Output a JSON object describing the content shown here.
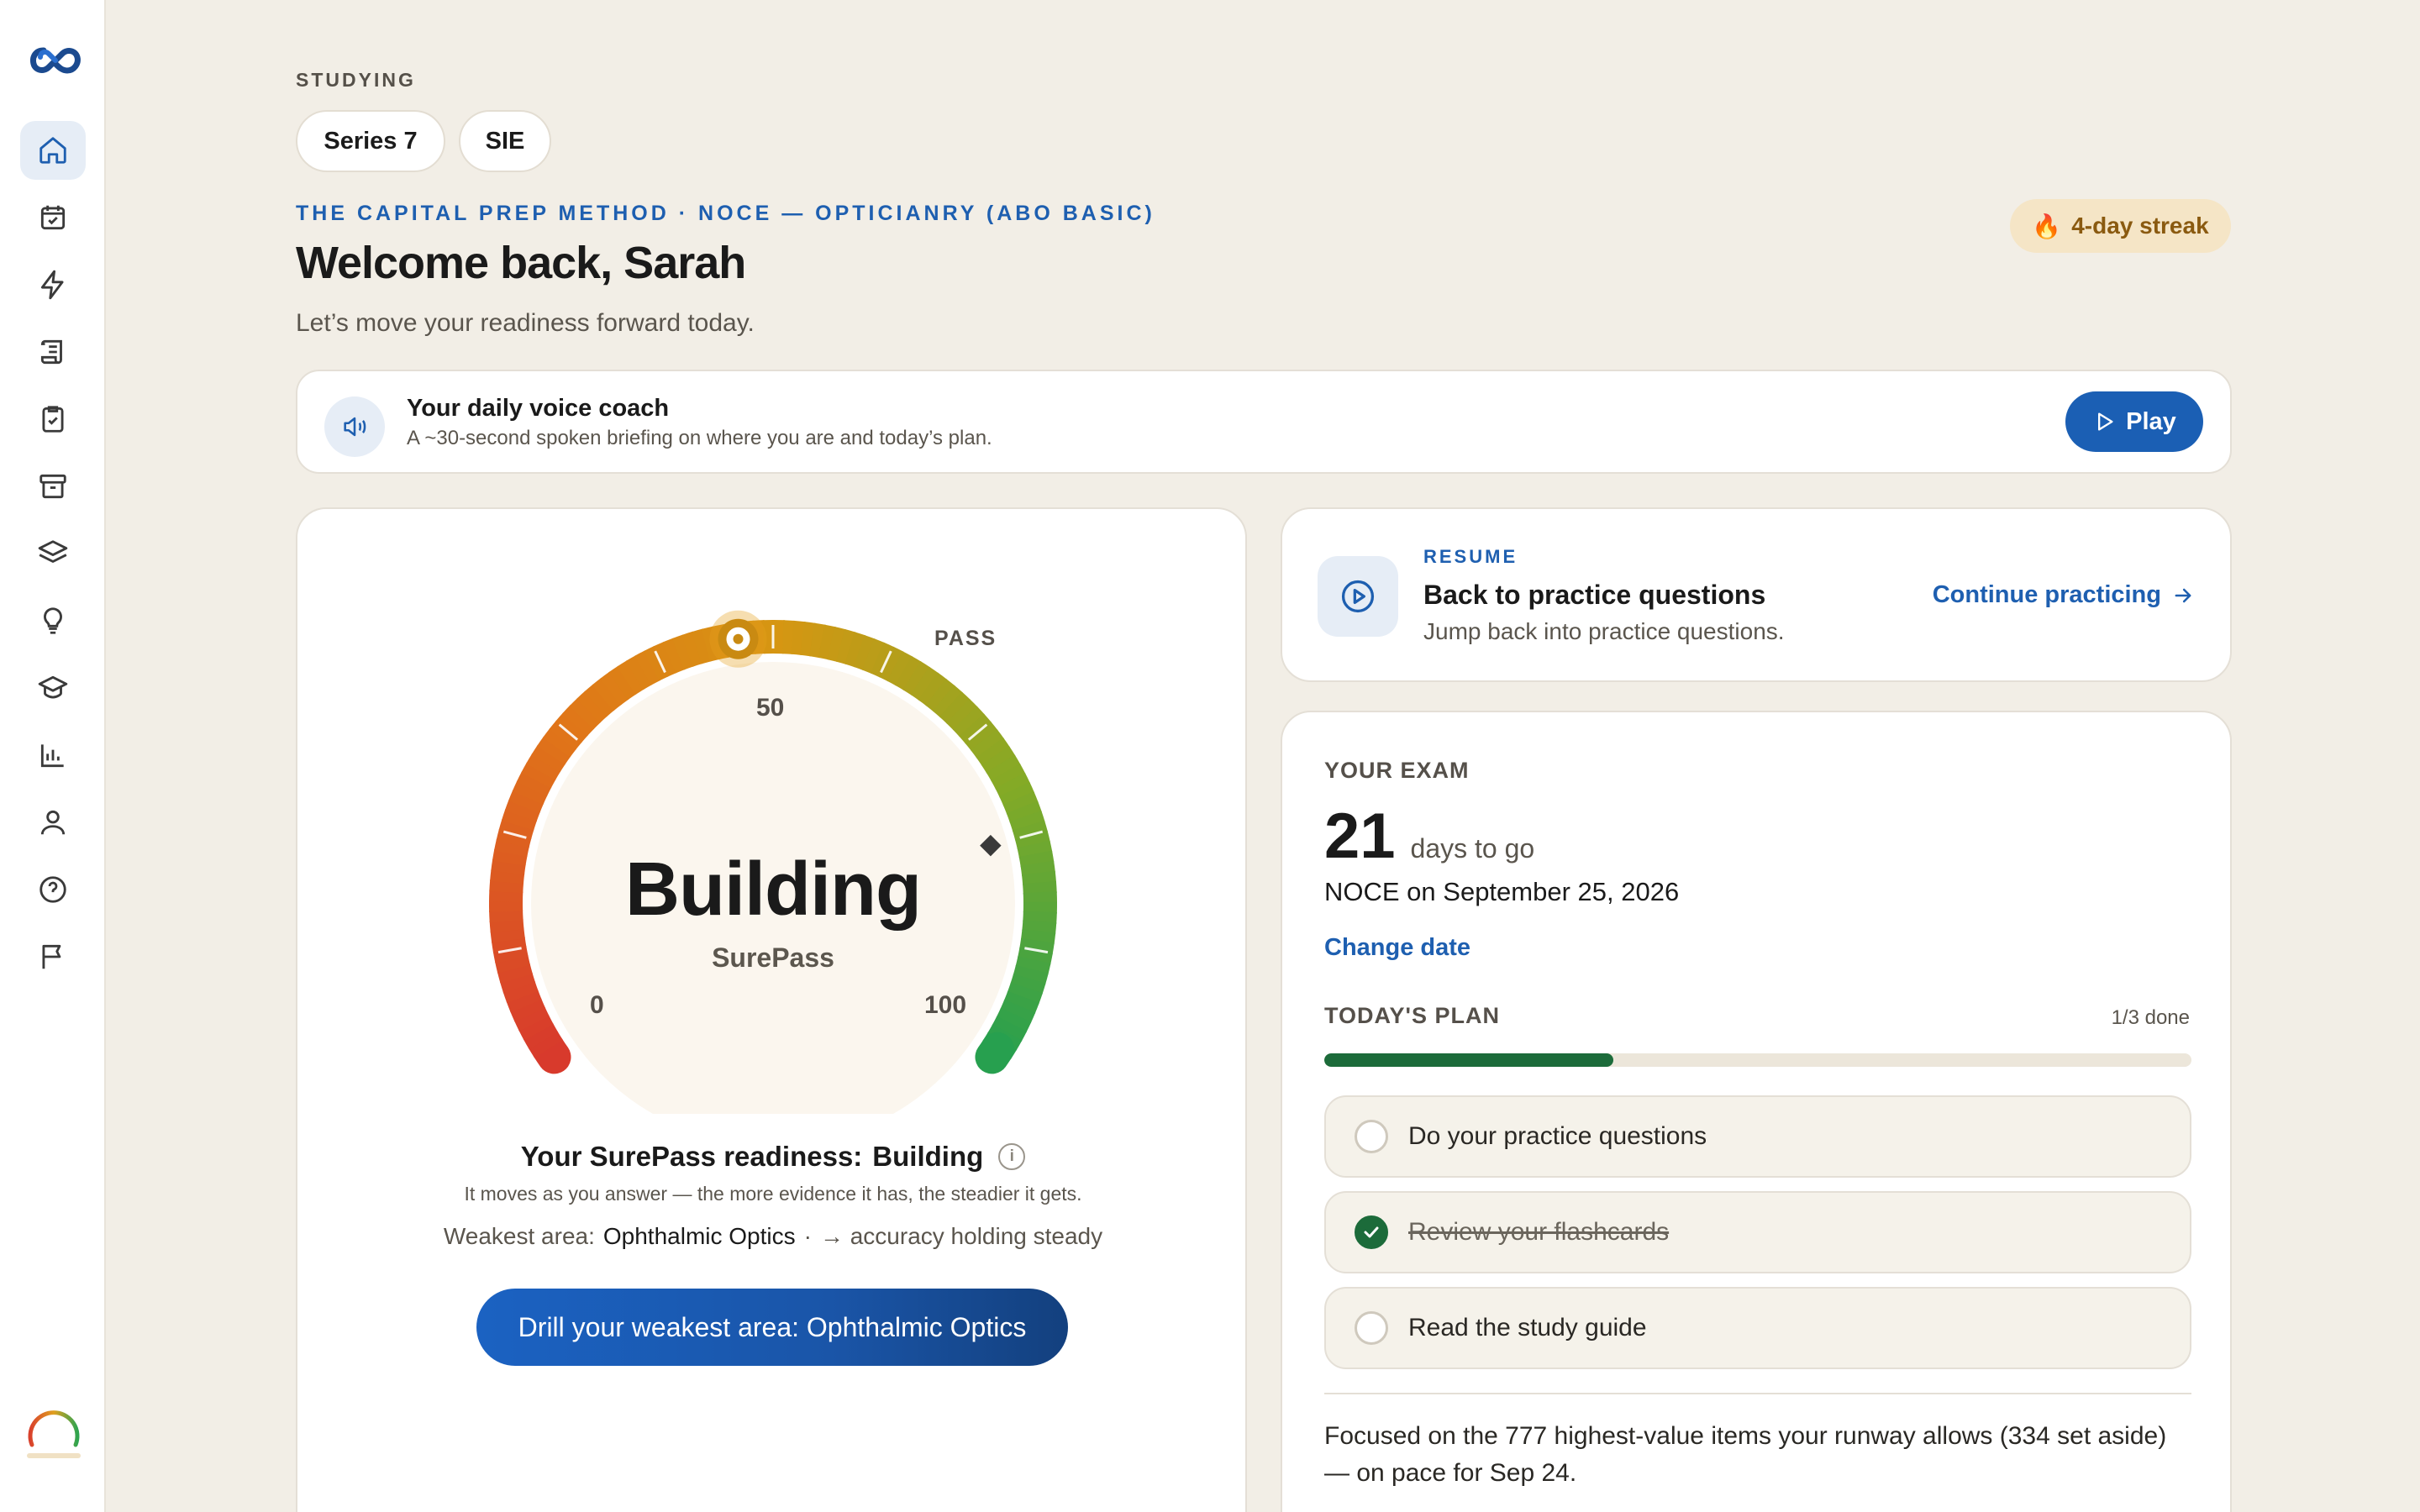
{
  "sidebar": {
    "logo": "infinity-logo",
    "items": [
      {
        "name": "home",
        "icon": "home-icon",
        "active": true
      },
      {
        "name": "calendar",
        "icon": "calendar-check-icon"
      },
      {
        "name": "quick-drill",
        "icon": "lightning-icon"
      },
      {
        "name": "study-guide",
        "icon": "scroll-icon"
      },
      {
        "name": "practice-tests",
        "icon": "clipboard-check-icon"
      },
      {
        "name": "archive",
        "icon": "archive-box-icon"
      },
      {
        "name": "flashcards",
        "icon": "layers-icon"
      },
      {
        "name": "tips",
        "icon": "lightbulb-icon"
      },
      {
        "name": "courses",
        "icon": "graduation-cap-icon"
      },
      {
        "name": "analytics",
        "icon": "bar-chart-icon"
      },
      {
        "name": "profile",
        "icon": "user-icon"
      },
      {
        "name": "help",
        "icon": "question-circle-icon"
      },
      {
        "name": "report",
        "icon": "flag-icon"
      }
    ]
  },
  "header": {
    "studying_label": "STUDYING",
    "exam_pills": [
      "Series 7",
      "SIE"
    ],
    "method_label": "THE CAPITAL PREP METHOD · NOCE — OPTICIANRY (ABO BASIC)",
    "welcome": "Welcome back, Sarah",
    "subtitle": "Let’s move your readiness forward today.",
    "streak": "4-day streak"
  },
  "voice_coach": {
    "title": "Your daily voice coach",
    "subtitle": "A ~30-second spoken briefing on where you are and today’s plan.",
    "play_label": "Play"
  },
  "readiness": {
    "gauge": {
      "min": 0,
      "max": 100,
      "value": 47,
      "pass_value": 80,
      "min_label": "0",
      "mid_label": "50",
      "max_label": "100",
      "pass_label": "PASS",
      "word": "Building",
      "brand": "SurePass"
    },
    "line_label": "Your SurePass readiness:",
    "line_value": "Building",
    "info_glyph": "i",
    "note": "It moves as you answer — the more evidence it has, the steadier it gets.",
    "weakest_prefix": "Weakest area:",
    "weakest_area": "Ophthalmic Optics",
    "weakest_separator": "·",
    "weakest_trend": "→ accuracy holding steady",
    "drill_button": "Drill your weakest area: Ophthalmic Optics"
  },
  "resume": {
    "eyebrow": "RESUME",
    "title": "Back to practice questions",
    "subtitle": "Jump back into practice questions.",
    "link": "Continue practicing"
  },
  "exam": {
    "eyebrow": "YOUR EXAM",
    "days": "21",
    "days_text": "days to go",
    "date_line": "NOCE on September 25, 2026",
    "change_date": "Change date",
    "plan_title": "TODAY'S PLAN",
    "plan_count": "1/3 done",
    "plan_progress": 0.333,
    "tasks": [
      {
        "label": "Do your practice questions",
        "done": false
      },
      {
        "label": "Review your flashcards",
        "done": true
      },
      {
        "label": "Read the study guide",
        "done": false
      }
    ],
    "focus_note": "Focused on the 777 highest-value items your runway allows (334 set aside) — on pace for Sep 24."
  },
  "colors": {
    "accent": "#1b5fb4",
    "success": "#1c6b3a",
    "background": "#f2eee6",
    "streak_bg": "#f5e5c6",
    "streak_text": "#8a5a10"
  }
}
